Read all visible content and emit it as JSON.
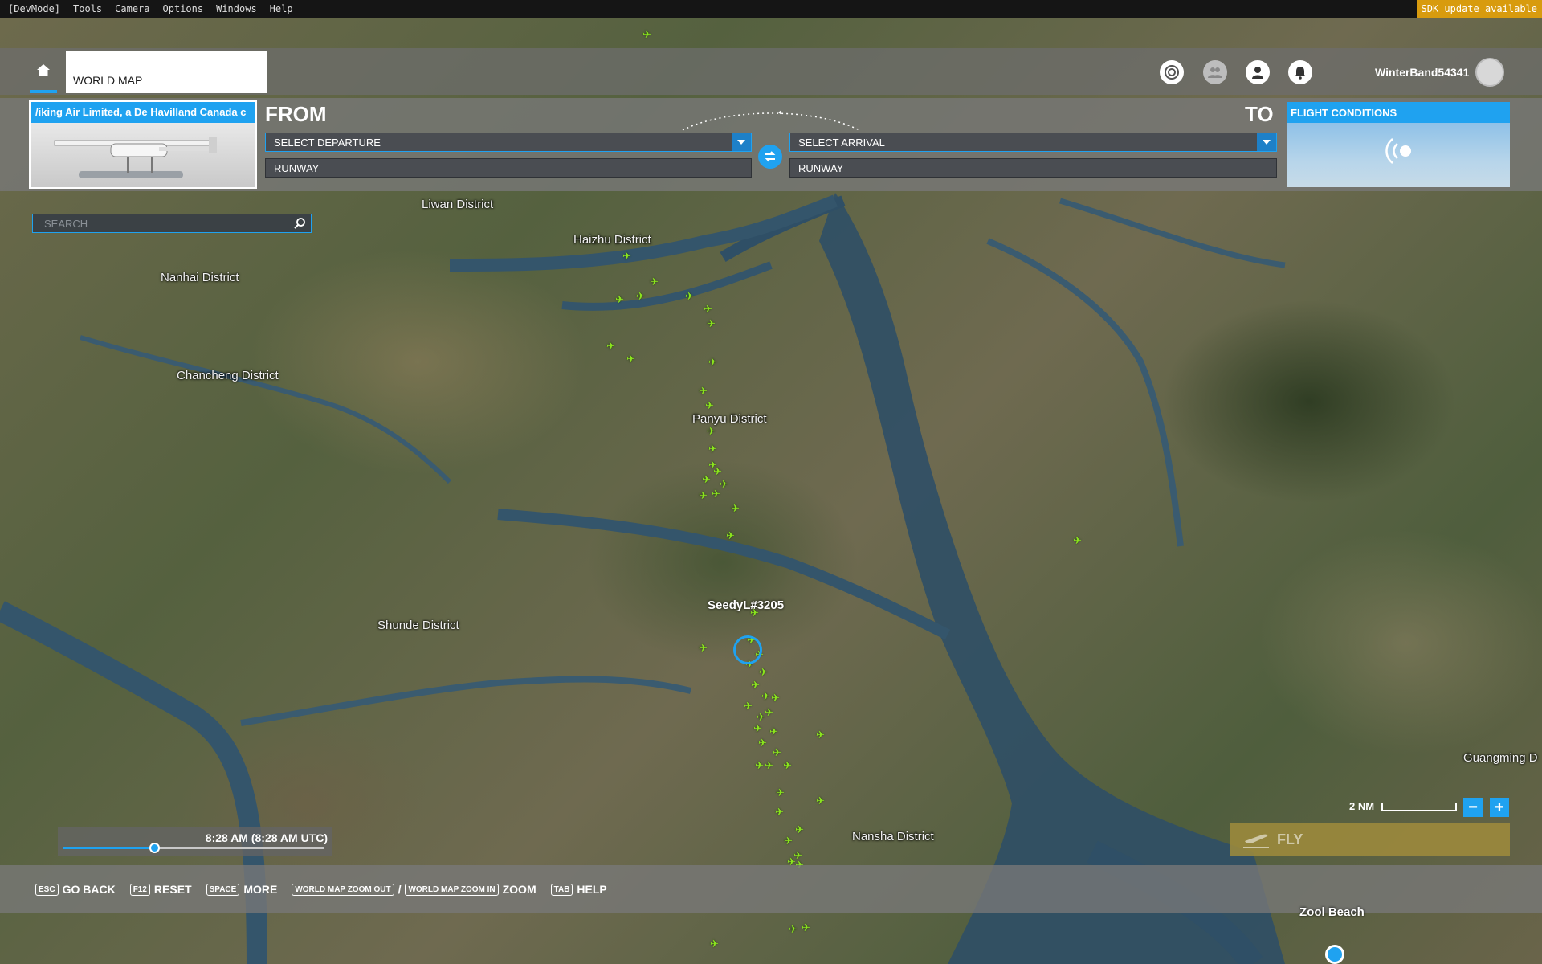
{
  "menu": {
    "items": [
      "[DevMode]",
      "Tools",
      "Camera",
      "Options",
      "Windows",
      "Help"
    ],
    "sdk_notice": "SDK update available"
  },
  "header": {
    "tab_label": "WORLD MAP",
    "username": "WinterBand54341"
  },
  "aircraft": {
    "name": "/iking Air Limited, a De Havilland Canada c"
  },
  "route": {
    "from_label": "FROM",
    "to_label": "TO",
    "departure_value": "SELECT DEPARTURE",
    "arrival_value": "SELECT ARRIVAL",
    "departure_runway": "RUNWAY",
    "arrival_runway": "RUNWAY"
  },
  "conditions": {
    "title": "FLIGHT CONDITIONS"
  },
  "search": {
    "placeholder": "SEARCH"
  },
  "map": {
    "districts": [
      "Liwan District",
      "Haizhu District",
      "Nanhai District",
      "Chancheng District",
      "Panyu District",
      "Shunde District",
      "Nansha District",
      "Guangming D"
    ],
    "player_label": "SeedyL#3205",
    "bottom_label": "Zool Beach"
  },
  "time": {
    "label": "8:28 AM (8:28 AM UTC)",
    "progress": 0.35
  },
  "zoom": {
    "scale_label": "2 NM",
    "minus": "−",
    "plus": "+"
  },
  "fly": {
    "label": "FLY"
  },
  "bottom_hints": [
    {
      "key": "ESC",
      "label": "GO BACK"
    },
    {
      "key": "F12",
      "label": "RESET"
    },
    {
      "key": "SPACE",
      "label": "MORE"
    },
    {
      "key": "WORLD MAP ZOOM OUT",
      "sep": "/",
      "key2": "WORLD MAP ZOOM IN",
      "label": "ZOOM"
    },
    {
      "key": "TAB",
      "label": "HELP"
    }
  ],
  "colors": {
    "accent": "#1fa2f0",
    "traffic": "#8be51e",
    "sdk": "#d89b0e"
  }
}
